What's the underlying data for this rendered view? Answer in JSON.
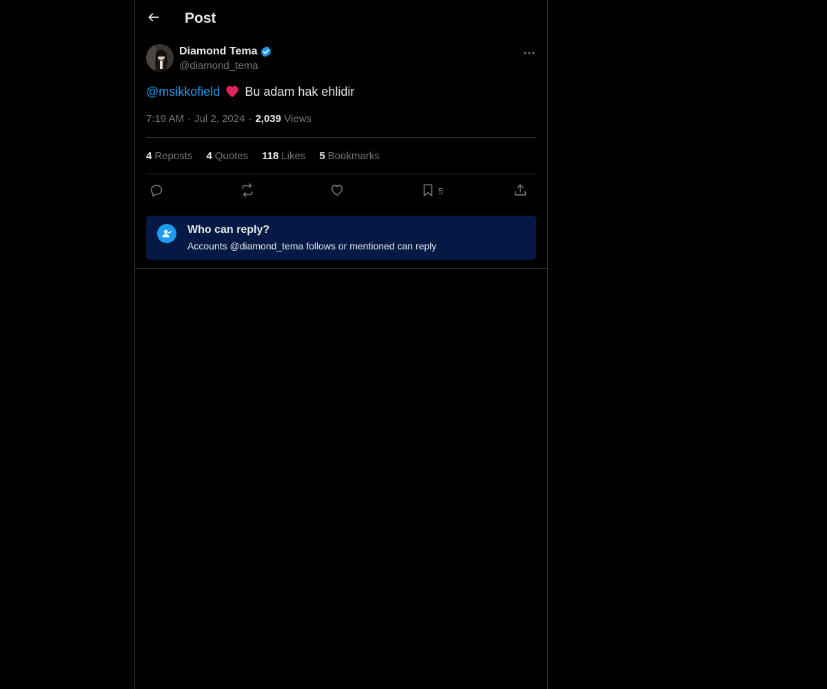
{
  "header": {
    "title": "Post"
  },
  "post": {
    "author": {
      "display_name": "Diamond Tema",
      "handle": "@diamond_tema",
      "verified": true
    },
    "text": {
      "mention": "@msikkofield",
      "emoji": "heart",
      "body": "Bu adam hak ehlidir"
    },
    "meta": {
      "time": "7:19 AM",
      "date": "Jul 2, 2024",
      "views_count": "2,039",
      "views_label": "Views",
      "separator": "·"
    },
    "stats": {
      "reposts_count": "4",
      "reposts_label": "Reposts",
      "quotes_count": "4",
      "quotes_label": "Quotes",
      "likes_count": "118",
      "likes_label": "Likes",
      "bookmarks_count": "5",
      "bookmarks_label": "Bookmarks"
    },
    "actions": {
      "bookmark_count": "5"
    },
    "reply_restriction": {
      "title": "Who can reply?",
      "description": "Accounts @diamond_tema follows or mentioned can reply"
    }
  },
  "colors": {
    "background": "#000000",
    "accent": "#1d9bf0",
    "muted": "#71767b",
    "border": "#2f3336",
    "reply_box": "#041a44",
    "heart": "#e0245e"
  },
  "icons": {
    "back": "arrow-left-icon",
    "verified": "verified-badge-icon",
    "more": "more-horizontal-icon",
    "reply": "reply-icon",
    "repost": "repost-icon",
    "like": "like-icon",
    "bookmark": "bookmark-icon",
    "share": "share-icon",
    "who_can_reply": "person-check-icon"
  }
}
